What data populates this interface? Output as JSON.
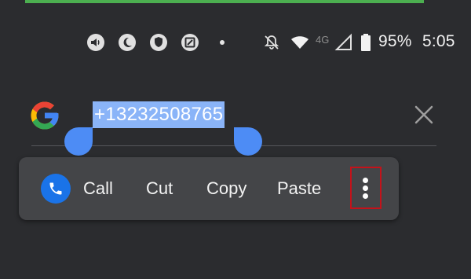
{
  "status_bar": {
    "icons_left": [
      "sound-icon",
      "do-not-disturb-icon",
      "shield-icon",
      "screenshot-icon",
      "notification-dot-icon"
    ],
    "icons_right": [
      "notifications-muted-icon",
      "wifi-icon",
      "signal-icon",
      "battery-icon"
    ],
    "network_type": "4G",
    "battery": "95%",
    "time": "5:05"
  },
  "search": {
    "query": "+13232508765",
    "selected": true
  },
  "selection_toolbar": {
    "call_label": "Call",
    "cut_label": "Cut",
    "copy_label": "Copy",
    "paste_label": "Paste",
    "more_icon": "more-vert-icon"
  },
  "colors": {
    "background": "#2b2c2f",
    "selection_highlight": "#8ab4f8",
    "handle": "#4d8cf5",
    "toolbar": "#444548",
    "highlight_box": "#c4121a",
    "top_bar": "#4caf50"
  }
}
